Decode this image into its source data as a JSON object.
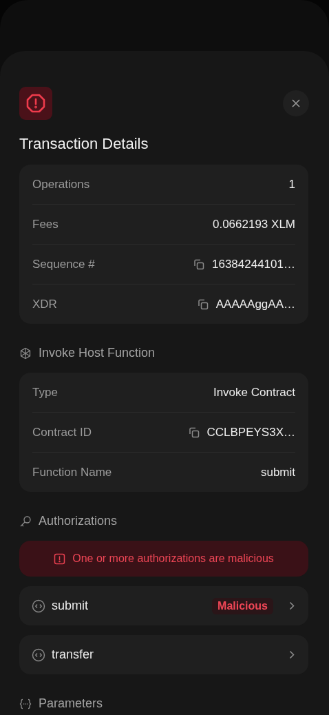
{
  "title": "Transaction Details",
  "details": [
    {
      "label": "Operations",
      "value": "1",
      "copyable": false
    },
    {
      "label": "Fees",
      "value": "0.0662193 XLM",
      "copyable": false
    },
    {
      "label": "Sequence #",
      "value": "16384244101…",
      "copyable": true
    },
    {
      "label": "XDR",
      "value": "AAAAAggAA…",
      "copyable": true
    }
  ],
  "invoke_host_function": {
    "heading": "Invoke Host Function",
    "rows": [
      {
        "label": "Type",
        "value": "Invoke Contract",
        "copyable": false
      },
      {
        "label": "Contract ID",
        "value": "CCLBPEYS3X…",
        "copyable": true
      },
      {
        "label": "Function Name",
        "value": "submit",
        "copyable": false
      }
    ]
  },
  "authorizations": {
    "heading": "Authorizations",
    "alert": "One or more authorizations are malicious",
    "items": [
      {
        "name": "submit",
        "badge": "Malicious"
      },
      {
        "name": "transfer"
      }
    ]
  },
  "parameters": {
    "heading": "Parameters"
  }
}
